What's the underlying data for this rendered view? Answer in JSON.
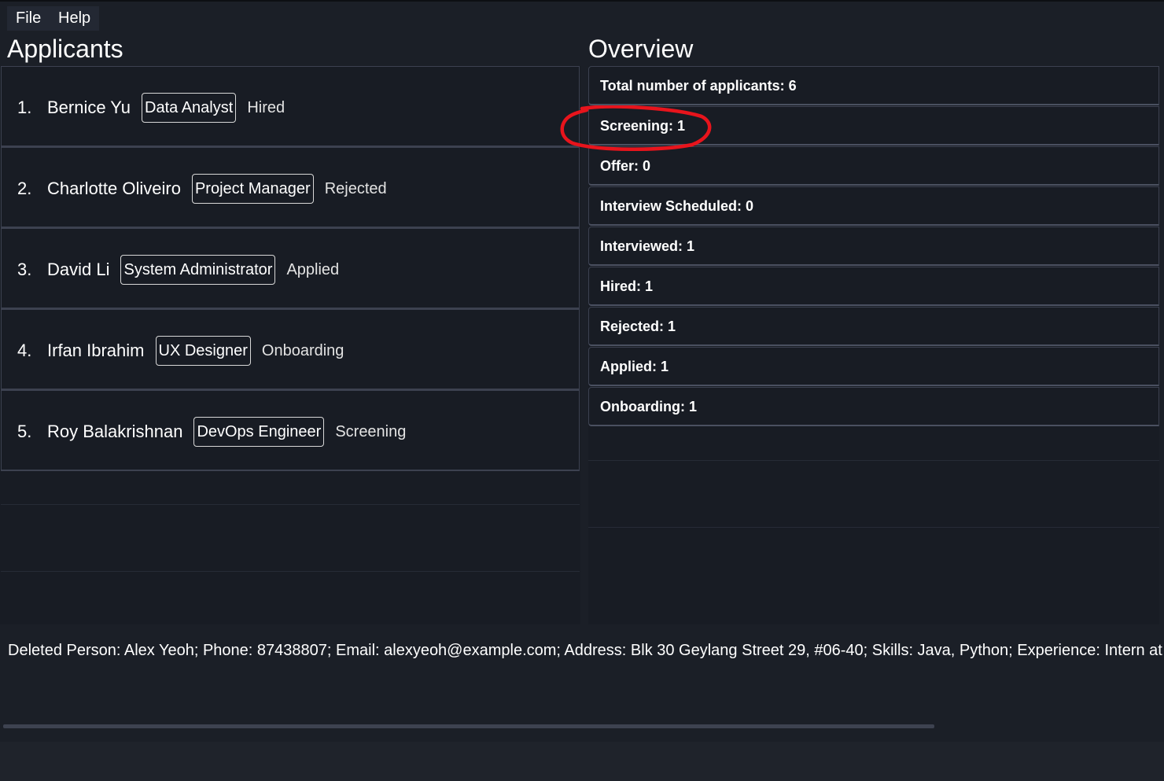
{
  "menu": {
    "file": "File",
    "help": "Help"
  },
  "applicants": {
    "title": "Applicants",
    "items": [
      {
        "index": "1.",
        "name": "Bernice Yu",
        "role": "Data Analyst",
        "status": "Hired"
      },
      {
        "index": "2.",
        "name": "Charlotte Oliveiro",
        "role": "Project Manager",
        "status": "Rejected"
      },
      {
        "index": "3.",
        "name": "David Li",
        "role": "System Administrator",
        "status": "Applied"
      },
      {
        "index": "4.",
        "name": "Irfan Ibrahim",
        "role": "UX Designer",
        "status": "Onboarding"
      },
      {
        "index": "5.",
        "name": "Roy Balakrishnan",
        "role": "DevOps Engineer",
        "status": "Screening"
      }
    ]
  },
  "overview": {
    "title": "Overview",
    "stats": [
      "Total number of applicants: 6",
      "Screening: 1",
      "Offer: 0",
      "Interview Scheduled: 0",
      "Interviewed: 1",
      "Hired: 1",
      "Rejected: 1",
      "Applied: 1",
      "Onboarding: 1"
    ]
  },
  "result": {
    "text": "Deleted Person: Alex Yeoh; Phone: 87438807; Email: alexyeoh@example.com; Address: Blk 30 Geylang Street 29, #06-40; Skills: Java, Python; Experience: Intern at NUS;"
  },
  "colors": {
    "background": "#1b1f27",
    "panel": "#181c24",
    "border": "#3c4150",
    "annotation": "#e8141c"
  }
}
